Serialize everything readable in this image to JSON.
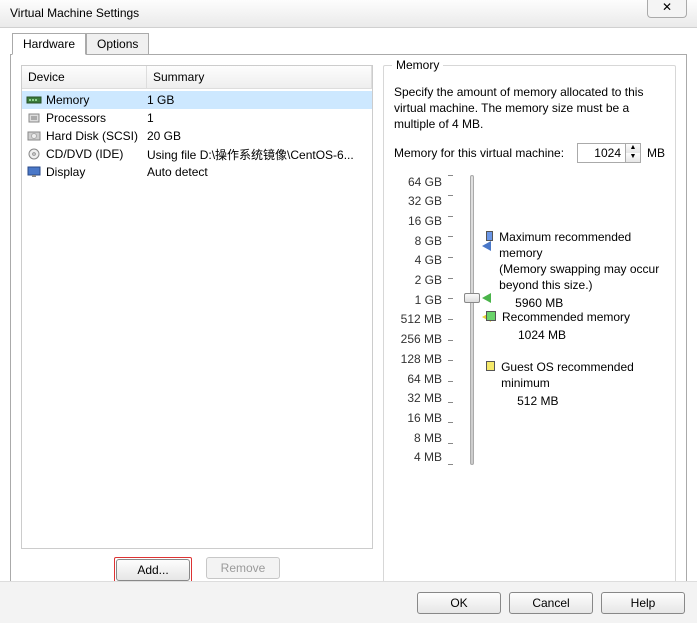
{
  "title": "Virtual Machine Settings",
  "tabs": {
    "hardware": "Hardware",
    "options": "Options"
  },
  "table": {
    "headers": {
      "device": "Device",
      "summary": "Summary"
    },
    "rows": [
      {
        "device": "Memory",
        "summary": "1 GB",
        "icon": "memory"
      },
      {
        "device": "Processors",
        "summary": "1",
        "icon": "cpu"
      },
      {
        "device": "Hard Disk (SCSI)",
        "summary": "20 GB",
        "icon": "disk"
      },
      {
        "device": "CD/DVD (IDE)",
        "summary": "Using file D:\\操作系统镜像\\CentOS-6...",
        "icon": "cd"
      },
      {
        "device": "Display",
        "summary": "Auto detect",
        "icon": "display"
      }
    ]
  },
  "buttons": {
    "add": "Add...",
    "remove": "Remove",
    "ok": "OK",
    "cancel": "Cancel",
    "help": "Help"
  },
  "memory_panel": {
    "group_title": "Memory",
    "desc": "Specify the amount of memory allocated to this virtual machine. The memory size must be a multiple of 4 MB.",
    "label": "Memory for this virtual machine:",
    "value": "1024",
    "unit": "MB",
    "ticks": [
      "64 GB",
      "32 GB",
      "16 GB",
      "8 GB",
      "4 GB",
      "2 GB",
      "1 GB",
      "512 MB",
      "256 MB",
      "128 MB",
      "64 MB",
      "32 MB",
      "16 MB",
      "8 MB",
      "4 MB"
    ],
    "legend": {
      "max": {
        "title": "Maximum recommended memory",
        "note": "(Memory swapping may occur beyond this size.)",
        "value": "5960 MB"
      },
      "rec": {
        "title": "Recommended memory",
        "value": "1024 MB"
      },
      "min": {
        "title": "Guest OS recommended minimum",
        "value": "512 MB"
      }
    }
  }
}
